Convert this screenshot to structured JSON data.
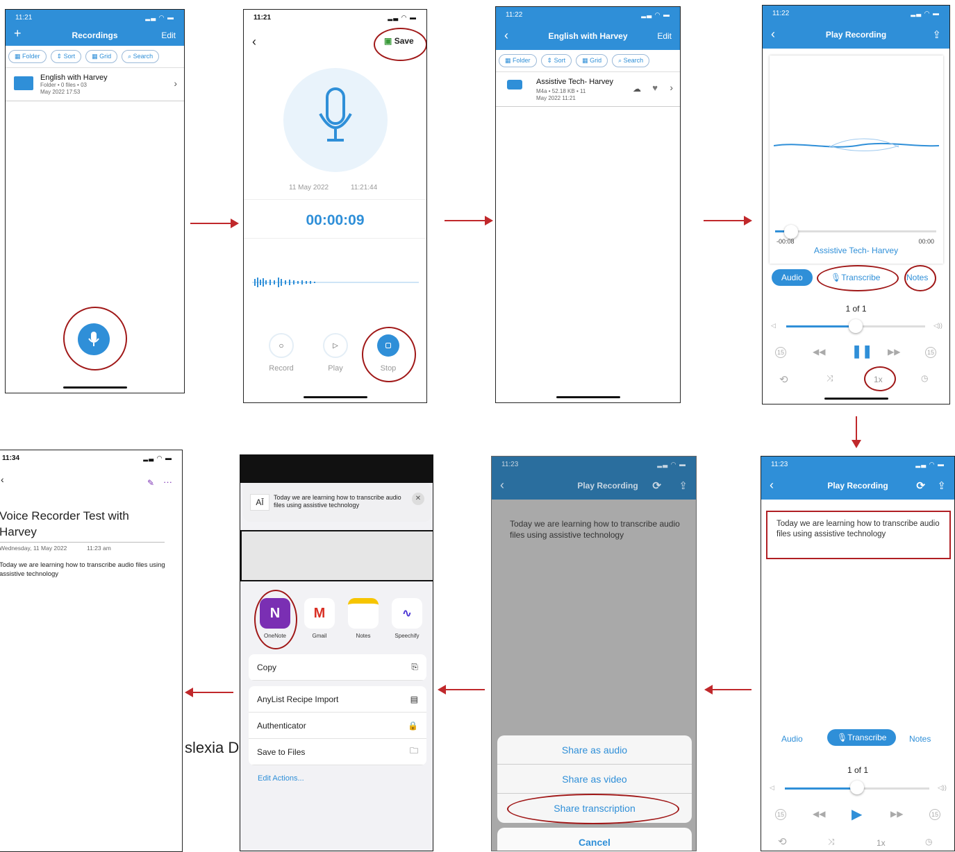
{
  "p1": {
    "time": "11:21",
    "title": "Recordings",
    "edit": "Edit",
    "chips": [
      "Folder",
      "Sort",
      "Grid",
      "Search"
    ],
    "folder_name": "English with Harvey",
    "folder_meta1": "Folder • 0 files • 03",
    "folder_meta2": "May 2022 17:53"
  },
  "p2": {
    "time": "11:21",
    "save": "Save",
    "date": "11 May 2022",
    "clock": "11:21:44",
    "elapsed": "00:00:09",
    "record": "Record",
    "play": "Play",
    "stop": "Stop"
  },
  "p3": {
    "time": "11:22",
    "title": "English with Harvey",
    "edit": "Edit",
    "chips": [
      "Folder",
      "Sort",
      "Grid",
      "Search"
    ],
    "file_name": "Assistive Tech- Harvey",
    "file_meta1": "M4a • 52.18 KB • 11",
    "file_meta2": "May 2022 11:21"
  },
  "p4": {
    "time": "11:22",
    "title": "Play Recording",
    "pos": "-00:08",
    "end": "00:00",
    "track": "Assistive Tech- Harvey",
    "tabs": [
      "Audio",
      "Transcribe",
      "Notes"
    ],
    "count": "1 of 1",
    "speed": "1x",
    "skip": "15",
    "volume_level": 0.5,
    "playback_progress": 0.1
  },
  "p5": {
    "time": "11:23",
    "title": "Play Recording",
    "transcript": "Today we are learning how to transcribe audio files using assistive technology",
    "tabs": [
      "Audio",
      "Transcribe",
      "Notes"
    ],
    "count": "1 of 1",
    "speed": "1x",
    "skip": "15",
    "volume_level": 0.5
  },
  "p6": {
    "time": "11:23",
    "title": "Play Recording",
    "transcript": "Today we are learning how to transcribe audio files using assistive technology",
    "share_audio": "Share as audio",
    "share_video": "Share as video",
    "share_transcription": "Share transcription",
    "cancel": "Cancel"
  },
  "p7": {
    "preview": "Today we are learning how to transcribe audio files using assistive technology",
    "apps": [
      "OneNote",
      "Gmail",
      "Notes",
      "Speechify"
    ],
    "actions": [
      "Copy",
      "AnyList Recipe Import",
      "Authenticator",
      "Save to Files"
    ],
    "edit_actions": "Edit Actions..."
  },
  "p8": {
    "time": "11:34",
    "title": "Voice Recorder Test with Harvey",
    "date": "Wednesday, 11 May 2022",
    "clock": "11:23 am",
    "body": "Today we are learning how to transcribe audio files using assistive technology"
  },
  "fragment": "slexia D"
}
